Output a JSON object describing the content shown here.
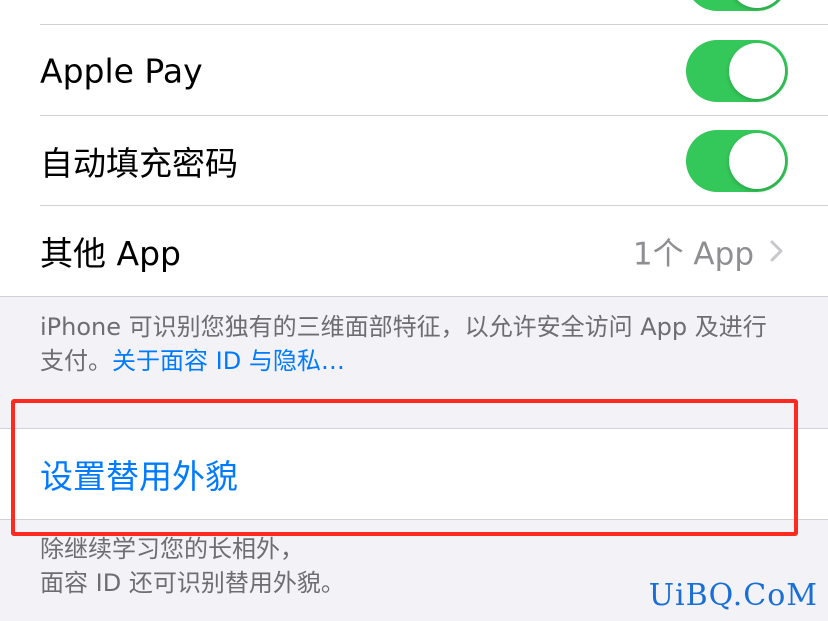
{
  "settings": {
    "rows": [
      {
        "label": "Apple Pay",
        "toggle": true
      },
      {
        "label": "自动填充密码",
        "toggle": true
      },
      {
        "label": "其他 App",
        "value": "1个 App"
      }
    ],
    "footer_text": "iPhone 可识别您独有的三维面部特征，以允许安全访问 App 及进行支付。",
    "footer_link": "关于面容 ID 与隐私…",
    "alt_appearance_label": "设置替用外貌",
    "alt_footer_line1": "除继续学习您的长相外，",
    "alt_footer_line2": "面容 ID 还可识别替用外貌。"
  },
  "colors": {
    "toggle_on": "#34c759",
    "link_blue": "#007aff",
    "highlight_red": "#ff2a1f"
  },
  "icons": {
    "disclosure": "chevron-right-icon"
  },
  "watermark": "UiBQ.CoM"
}
